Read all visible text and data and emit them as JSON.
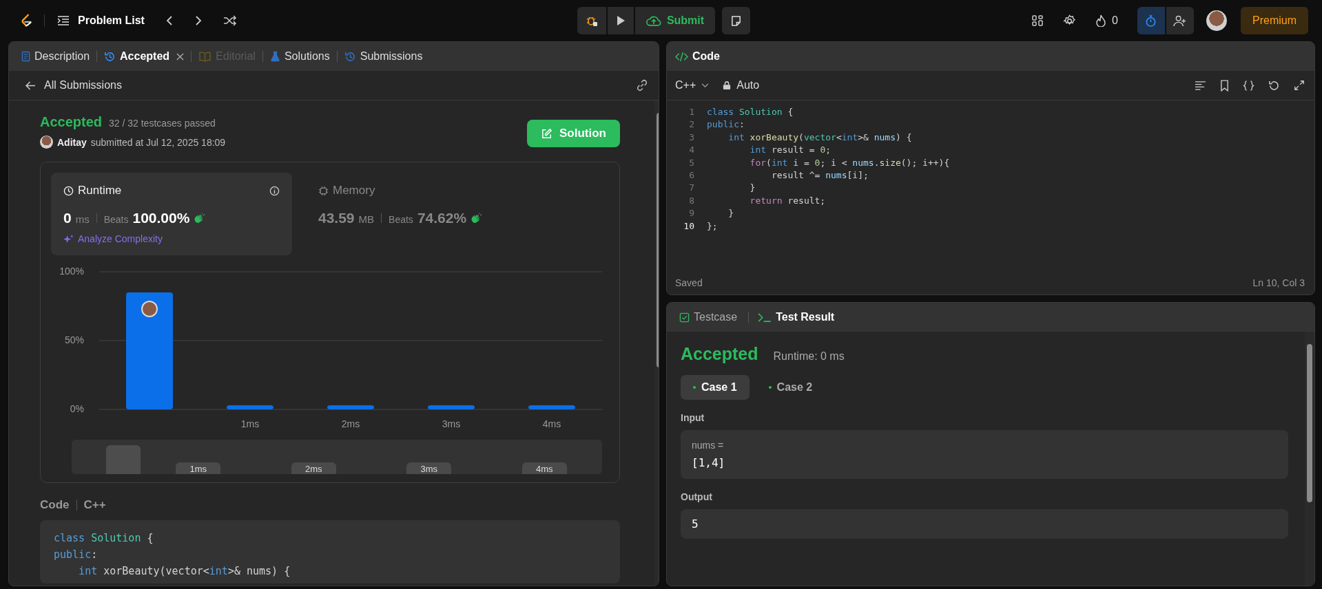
{
  "top_bar": {
    "title": "Problem List",
    "submit": "Submit",
    "streak": "0",
    "premium": "Premium",
    "timer_active": true
  },
  "left_panel": {
    "tabs": [
      {
        "label": "Description",
        "selected": false,
        "disabled": false,
        "closable": false
      },
      {
        "label": "Accepted",
        "selected": true,
        "disabled": false,
        "closable": true
      },
      {
        "label": "Editorial",
        "selected": false,
        "disabled": true,
        "closable": false
      },
      {
        "label": "Solutions",
        "selected": false,
        "disabled": false,
        "closable": false
      },
      {
        "label": "Submissions",
        "selected": false,
        "disabled": false,
        "closable": false
      }
    ],
    "back_link": "All Submissions",
    "submission": {
      "status": "Accepted",
      "testcases": "32 / 32 testcases passed",
      "user": "Aditay",
      "submitted": "submitted at Jul 12, 2025 18:09",
      "solution_button": "Solution"
    },
    "stats": [
      {
        "kind": "runtime",
        "title": "Runtime",
        "value": "0",
        "unit": "ms",
        "beats_label": "Beats",
        "beats": "100.00%",
        "selected": true,
        "action": "Analyze Complexity"
      },
      {
        "kind": "memory",
        "title": "Memory",
        "value": "43.59",
        "unit": "MB",
        "beats_label": "Beats",
        "beats": "74.62%",
        "selected": false
      }
    ],
    "chart_data": {
      "type": "bar",
      "x": [
        0,
        1,
        2,
        3,
        4
      ],
      "xlim": [
        -0.5,
        4.5
      ],
      "xticks": [
        {
          "value": 1,
          "label": "1ms"
        },
        {
          "value": 2,
          "label": "2ms"
        },
        {
          "value": 3,
          "label": "3ms"
        },
        {
          "value": 4,
          "label": "4ms"
        }
      ],
      "ylim": [
        0,
        100
      ],
      "yticks": [
        {
          "value": 0,
          "label": "0%"
        },
        {
          "value": 50,
          "label": "50%"
        },
        {
          "value": 100,
          "label": "100%"
        }
      ],
      "series": [
        {
          "color": "#0a6fe8",
          "values": [
            85,
            3,
            3,
            3,
            3
          ]
        }
      ]
    },
    "navigator_labels": [
      "1ms",
      "2ms",
      "3ms",
      "4ms"
    ],
    "code_section": {
      "title": "Code",
      "language": "C++",
      "lines": [
        [
          {
            "text": "class",
            "kind": "keyword"
          },
          {
            "text": " Solution",
            "kind": "type"
          },
          {
            "text": " {",
            "kind": "plain"
          }
        ],
        [
          {
            "text": "public",
            "kind": "keyword"
          },
          {
            "text": ":",
            "kind": "plain"
          }
        ],
        [
          {
            "text": "    int",
            "kind": "keyword"
          },
          {
            "text": " xorBeauty(vector<",
            "kind": "plain"
          },
          {
            "text": "int",
            "kind": "keyword"
          },
          {
            "text": ">& nums) {",
            "kind": "plain"
          }
        ]
      ]
    }
  },
  "code_panel": {
    "title": "Code",
    "language": "C++",
    "mode": "Auto",
    "lines": [
      {
        "n": "1",
        "current": false,
        "tokens": [
          {
            "text": "class",
            "kind": "keyword"
          },
          {
            "text": " Solution",
            "kind": "type"
          },
          {
            "text": " {",
            "kind": "plain"
          }
        ]
      },
      {
        "n": "2",
        "current": false,
        "tokens": [
          {
            "text": "public",
            "kind": "keyword"
          },
          {
            "text": ":",
            "kind": "plain"
          }
        ]
      },
      {
        "n": "3",
        "current": false,
        "tokens": [
          {
            "text": "    int",
            "kind": "keyword"
          },
          {
            "text": " xorBeauty",
            "kind": "function"
          },
          {
            "text": "(",
            "kind": "plain"
          },
          {
            "text": "vector",
            "kind": "type"
          },
          {
            "text": "<",
            "kind": "plain"
          },
          {
            "text": "int",
            "kind": "keyword"
          },
          {
            "text": ">&",
            "kind": "plain"
          },
          {
            "text": " nums",
            "kind": "variable"
          },
          {
            "text": ") {",
            "kind": "plain"
          }
        ]
      },
      {
        "n": "4",
        "current": false,
        "tokens": [
          {
            "text": "        int",
            "kind": "keyword"
          },
          {
            "text": " result = ",
            "kind": "plain"
          },
          {
            "text": "0",
            "kind": "number"
          },
          {
            "text": ";",
            "kind": "plain"
          }
        ]
      },
      {
        "n": "5",
        "current": false,
        "tokens": [
          {
            "text": "        for",
            "kind": "control"
          },
          {
            "text": "(",
            "kind": "plain"
          },
          {
            "text": "int",
            "kind": "keyword"
          },
          {
            "text": " i = ",
            "kind": "plain"
          },
          {
            "text": "0",
            "kind": "number"
          },
          {
            "text": "; i < ",
            "kind": "plain"
          },
          {
            "text": "nums",
            "kind": "variable"
          },
          {
            "text": ".",
            "kind": "plain"
          },
          {
            "text": "size",
            "kind": "function"
          },
          {
            "text": "(); i++){",
            "kind": "plain"
          }
        ]
      },
      {
        "n": "6",
        "current": false,
        "tokens": [
          {
            "text": "            result ^=",
            "kind": "plain"
          },
          {
            "text": " nums",
            "kind": "variable"
          },
          {
            "text": "[i];",
            "kind": "plain"
          }
        ]
      },
      {
        "n": "7",
        "current": false,
        "tokens": [
          {
            "text": "        }",
            "kind": "plain"
          }
        ]
      },
      {
        "n": "8",
        "current": false,
        "tokens": [
          {
            "text": "        return",
            "kind": "control"
          },
          {
            "text": " result;",
            "kind": "plain"
          }
        ]
      },
      {
        "n": "9",
        "current": false,
        "tokens": [
          {
            "text": "    }",
            "kind": "plain"
          }
        ]
      },
      {
        "n": "10",
        "current": true,
        "tokens": [
          {
            "text": "};",
            "kind": "plain"
          }
        ]
      }
    ],
    "status": "Saved",
    "cursor": "Ln 10, Col 3"
  },
  "test_panel": {
    "tabs": [
      {
        "label": "Testcase",
        "selected": false
      },
      {
        "label": "Test Result",
        "selected": true
      }
    ],
    "status": "Accepted",
    "runtime": "Runtime: 0 ms",
    "cases": [
      {
        "label": "Case 1",
        "selected": true
      },
      {
        "label": "Case 2",
        "selected": false
      }
    ],
    "input_label": "Input",
    "inputs": [
      {
        "name": "nums =",
        "value": "[1,4]"
      }
    ],
    "output_label": "Output",
    "output": "5"
  }
}
